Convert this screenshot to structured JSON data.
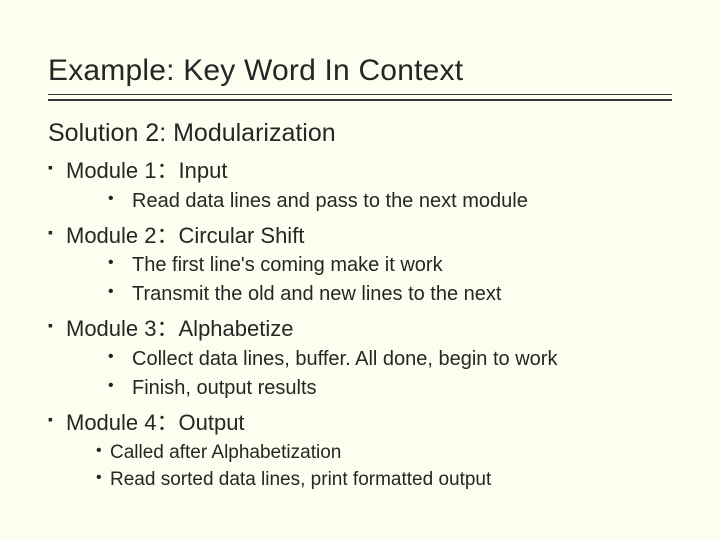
{
  "title": "Example: Key Word In Context",
  "subtitle": "Solution 2: Modularization",
  "modules": [
    {
      "heading": "Module 1：Input",
      "points": [
        "Read data lines and pass to the next module"
      ]
    },
    {
      "heading": "Module 2：Circular Shift",
      "points": [
        "The first line's coming make it work",
        "Transmit the old and new lines to the next"
      ]
    },
    {
      "heading": "Module 3：Alphabetize",
      "points": [
        "Collect data lines, buffer. All done, begin to work",
        "Finish, output results"
      ]
    },
    {
      "heading": "Module 4：Output",
      "points": [
        "Called after Alphabetization",
        "Read sorted data lines, print formatted output"
      ],
      "tight": true
    }
  ]
}
